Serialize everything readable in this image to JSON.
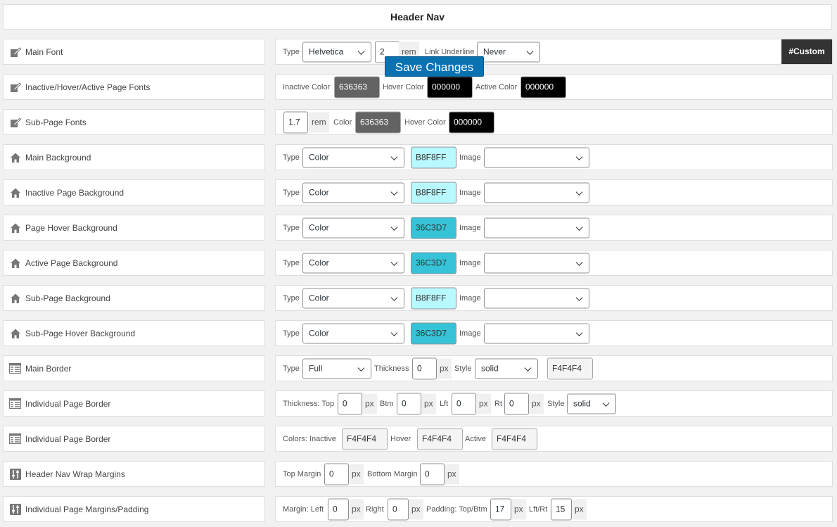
{
  "header": {
    "title": "Header Nav"
  },
  "save_button": "Save Changes",
  "rows": [
    {
      "label": "Main Font",
      "icon": "edit-icon"
    },
    {
      "label": "Inactive/Hover/Active Page Fonts",
      "icon": "edit-icon"
    },
    {
      "label": "Sub-Page Fonts",
      "icon": "edit-icon"
    },
    {
      "label": "Main Background",
      "icon": "home-icon"
    },
    {
      "label": "Inactive Page Background",
      "icon": "home-icon"
    },
    {
      "label": "Page Hover Background",
      "icon": "home-icon"
    },
    {
      "label": "Active Page Background",
      "icon": "home-icon"
    },
    {
      "label": "Sub-Page Background",
      "icon": "home-icon"
    },
    {
      "label": "Sub-Page Hover Background",
      "icon": "home-icon"
    },
    {
      "label": "Main Border",
      "icon": "table-icon"
    },
    {
      "label": "Individual Page Border",
      "icon": "table-icon"
    },
    {
      "label": "Individual Page Border",
      "icon": "table-icon"
    },
    {
      "label": "Header Nav Wrap Margins",
      "icon": "sliders-icon"
    },
    {
      "label": "Individual Page Margins/Padding",
      "icon": "sliders-icon"
    }
  ],
  "main_font": {
    "type_label": "Type",
    "type_value": "Helvetica",
    "size": "2",
    "unit": "rem",
    "underline_label": "Link Underline",
    "underline_value": "Never",
    "custom_label": "#Custom"
  },
  "page_fonts": {
    "inactive_label": "Inactive Color",
    "inactive": "636363",
    "hover_label": "Hover Color",
    "hover": "000000",
    "active_label": "Active Color",
    "active": "000000"
  },
  "sub_fonts": {
    "size": "1.7",
    "unit": "rem",
    "color_label": "Color",
    "color": "636363",
    "hover_label": "Hover Color",
    "hover": "000000"
  },
  "bg": {
    "type_label": "Type",
    "image_label": "Image",
    "type_value": "Color",
    "colors": [
      "B8F8FF",
      "B8F8FF",
      "36C3D7",
      "36C3D7",
      "B8F8FF",
      "36C3D7"
    ]
  },
  "main_border": {
    "type_label": "Type",
    "type_value": "Full",
    "thickness_label": "Thickness",
    "thickness": "0",
    "unit": "px",
    "style_label": "Style",
    "style_value": "solid",
    "color": "F4F4F4"
  },
  "page_border": {
    "thickness_label": "Thickness: Top",
    "top": "0",
    "btm_label": "Btm",
    "btm": "0",
    "lft_label": "Lft",
    "lft": "0",
    "rt_label": "Rt",
    "rt": "0",
    "unit": "px",
    "style_label": "Style",
    "style_value": "solid"
  },
  "page_border_colors": {
    "label": "Colors: Inactive",
    "inactive": "F4F4F4",
    "hover_label": "Hover",
    "hover": "F4F4F4",
    "active_label": "Active",
    "active": "F4F4F4"
  },
  "wrap_margins": {
    "top_label": "Top Margin",
    "top": "0",
    "bottom_label": "Bottom Margin",
    "bottom": "0",
    "unit": "px"
  },
  "page_margins": {
    "left_label": "Margin: Left",
    "left": "0",
    "right_label": "Right",
    "right": "0",
    "pad_label": "Padding: Top/Btm",
    "pad_tb": "17",
    "lr_label": "Lft/Rt",
    "pad_lr": "15",
    "unit": "px"
  },
  "colors": {
    "dark": "#636363",
    "black": "#000000",
    "light_cyan": "#B8F8FF",
    "cyan": "#36C3D7",
    "border_grey": "#F4F4F4"
  }
}
